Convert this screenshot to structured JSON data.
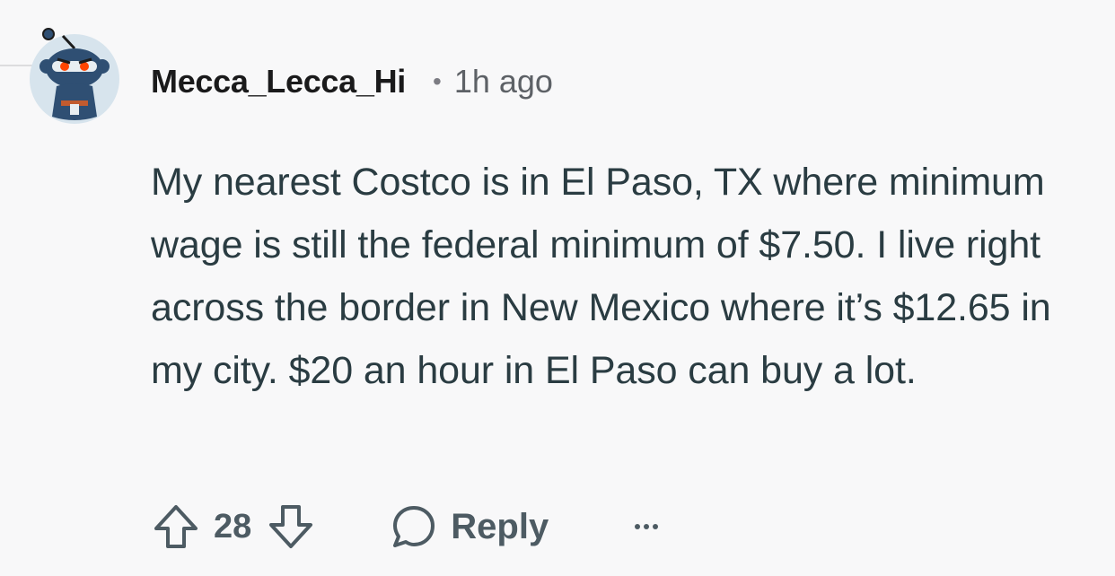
{
  "comment": {
    "username": "Mecca_Lecca_Hi",
    "separator": "•",
    "timestamp": "1h ago",
    "text": "My nearest Costco is in El Paso, TX where minimum wage is still the federal minimum of $7.50. I live right across the border in New Mexico where it’s $12.65 in my city. $20 an hour in El Paso can buy a lot."
  },
  "actions": {
    "vote_count": "28",
    "reply_label": "Reply"
  },
  "icons": {
    "avatar": "snoo-ninja-avatar",
    "upvote": "arrow-up-icon",
    "downvote": "arrow-down-icon",
    "reply": "speech-bubble-icon",
    "more": "ellipsis-icon"
  },
  "colors": {
    "background": "#f8f8f9",
    "text": "#2a3c42",
    "meta": "#5d6166",
    "avatar_bg": "#d7e4ed",
    "avatar_body": "#2f4f73",
    "avatar_accent": "#ff4500"
  }
}
